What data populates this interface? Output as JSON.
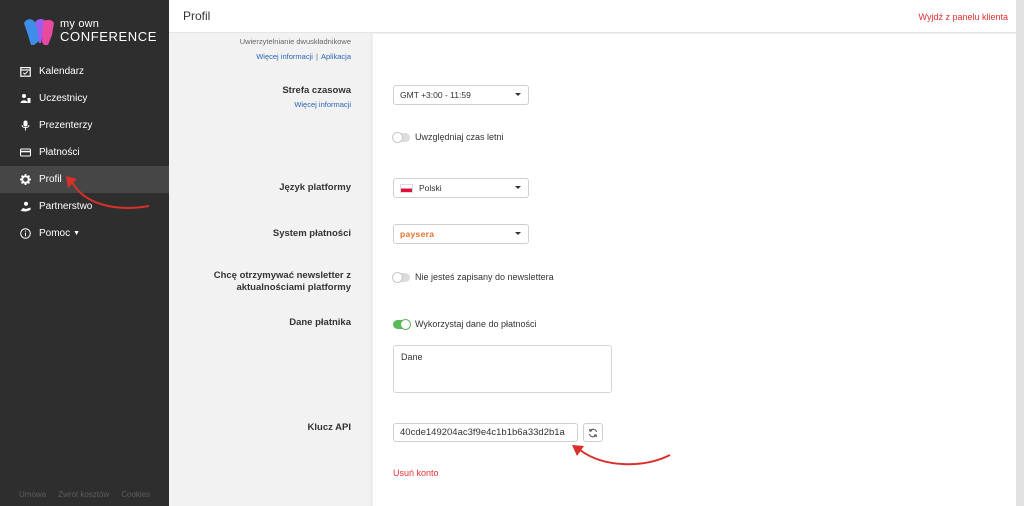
{
  "brand": {
    "line1": "my own",
    "line2": "CONFERENCE"
  },
  "sidebar": {
    "items": [
      {
        "label": "Kalendarz",
        "icon": "calendar-icon"
      },
      {
        "label": "Uczestnicy",
        "icon": "users-icon"
      },
      {
        "label": "Prezenterzy",
        "icon": "microphone-icon"
      },
      {
        "label": "Płatności",
        "icon": "credit-card-icon"
      },
      {
        "label": "Profil",
        "icon": "gear-icon"
      },
      {
        "label": "Partnerstwo",
        "icon": "partnership-icon"
      },
      {
        "label": "Pomoc",
        "icon": "info-icon"
      }
    ],
    "footer": [
      "Umowa",
      "Zwrot kosztów",
      "Cookies"
    ]
  },
  "header": {
    "title": "Profil",
    "exit": "Wyjdź z panelu klienta"
  },
  "form": {
    "twofa": {
      "label": "Uwierzytelnianie dwuskładnikowe",
      "more": "Więcej informacji",
      "separator": "|",
      "app": "Aplikacja"
    },
    "timezone": {
      "label": "Strefa czasowa",
      "more": "Więcej informacji",
      "value": "GMT +3:00 - 11:59"
    },
    "dst": {
      "label": "Uwzględniaj czas letni",
      "on": false
    },
    "language": {
      "label": "Język platformy",
      "value": "Polski"
    },
    "payment_system": {
      "label": "System płatności",
      "value": "paysera"
    },
    "newsletter": {
      "label_line1": "Chcę otrzymywać newsletter z",
      "label_line2": "aktualnościami platformy",
      "toggle_label": "Nie jesteś zapisany do newslettera",
      "on": false
    },
    "payer": {
      "label": "Dane płatnika",
      "toggle_label": "Wykorzystaj dane do płatności",
      "on": true,
      "textarea_value": "Dane"
    },
    "api": {
      "label": "Klucz API",
      "value": "40cde149204ac3f9e4c1b1b6a33d2b1a"
    },
    "delete_account": "Usuń konto"
  },
  "colors": {
    "sidebar": "#2e2e2e",
    "accent_red": "#e03131",
    "link_blue": "#2a64b7",
    "toggle_on": "#5cb85c",
    "paysera_orange": "#e8702a"
  }
}
